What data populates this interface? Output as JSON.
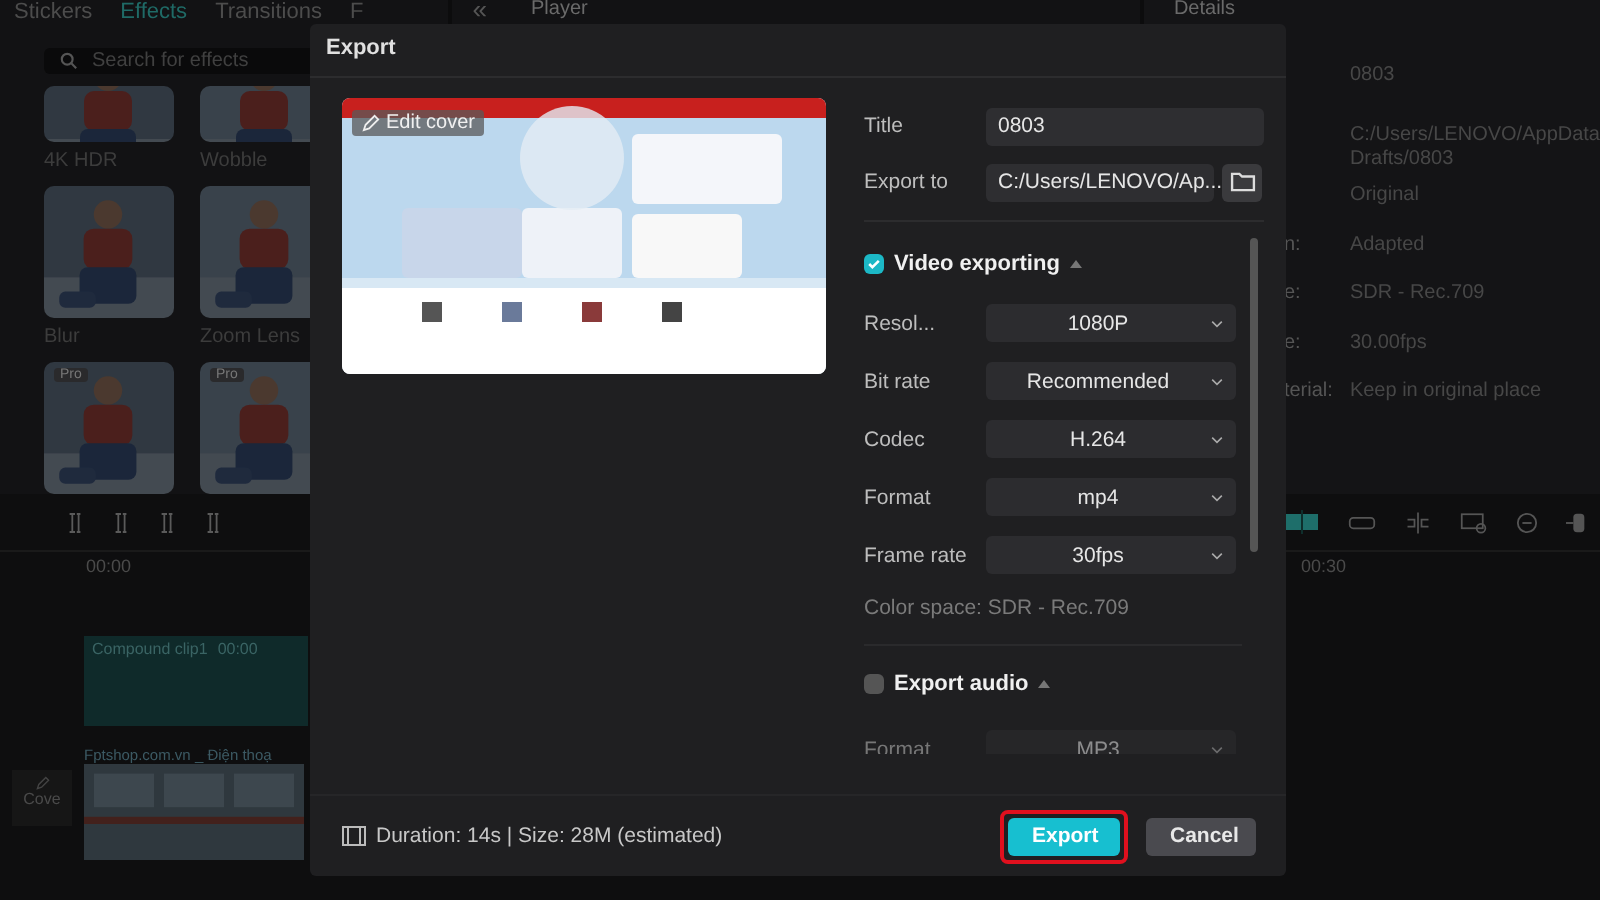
{
  "effects_panel": {
    "tabs": [
      {
        "label": "Stickers",
        "selected": false
      },
      {
        "label": "Effects",
        "selected": true
      },
      {
        "label": "Transitions",
        "selected": false
      },
      {
        "label": "F",
        "selected": false
      }
    ],
    "search": {
      "placeholder": "Search for effects"
    },
    "effects": [
      {
        "name": "4K HDR"
      },
      {
        "name": "Wobble"
      },
      {
        "name": "Blur"
      },
      {
        "name": "Zoom Lens"
      },
      {
        "badge": "Pro"
      },
      {
        "badge": "Pro"
      }
    ]
  },
  "player": {
    "title": "Player",
    "collapse": "«"
  },
  "details": {
    "title": "Details",
    "rows": [
      {
        "value": "0803"
      },
      {
        "value": "C:/Users/LENOVO/AppData"
      },
      {
        "value": "Drafts/0803"
      },
      {
        "value": "Original"
      },
      {
        "label": "n:",
        "value": "Adapted"
      },
      {
        "label": "e:",
        "value": "SDR - Rec.709"
      },
      {
        "label": "e:",
        "value": "30.00fps"
      },
      {
        "label": "terial:",
        "value": "Keep in original place"
      }
    ]
  },
  "timeline": {
    "start_time": "00:00",
    "end_time": "00:30",
    "cover_label": "Cove",
    "tracks": [
      {
        "kind": "compound",
        "label": "Compound clip1",
        "time": "00:00"
      },
      {
        "kind": "video",
        "label": "Fptshop.com.vn _ Điện thoạ"
      }
    ]
  },
  "dialog": {
    "title": "Export",
    "edit_cover": "Edit cover",
    "fields": [
      {
        "kind": "text",
        "label": "Title",
        "value": "0803"
      },
      {
        "kind": "path",
        "label": "Export to",
        "value": "C:/Users/LENOVO/Ap..."
      }
    ],
    "video": {
      "label": "Video exporting",
      "checked": true,
      "expanded": true,
      "settings": [
        {
          "label": "Resol...",
          "value": "1080P"
        },
        {
          "label": "Bit rate",
          "value": "Recommended"
        },
        {
          "label": "Codec",
          "value": "H.264"
        },
        {
          "label": "Format",
          "value": "mp4"
        },
        {
          "label": "Frame rate",
          "value": "30fps"
        }
      ],
      "color_space": "Color space: SDR - Rec.709"
    },
    "audio": {
      "label": "Export audio",
      "checked": false,
      "expanded": true,
      "settings": [
        {
          "label": "Format",
          "value": "MP3"
        }
      ]
    },
    "summary": "Duration: 14s | Size: 28M (estimated)",
    "buttons": [
      {
        "kind": "primary",
        "label": "Export",
        "highlighted": true
      },
      {
        "kind": "secondary",
        "label": "Cancel",
        "highlighted": false
      }
    ]
  }
}
